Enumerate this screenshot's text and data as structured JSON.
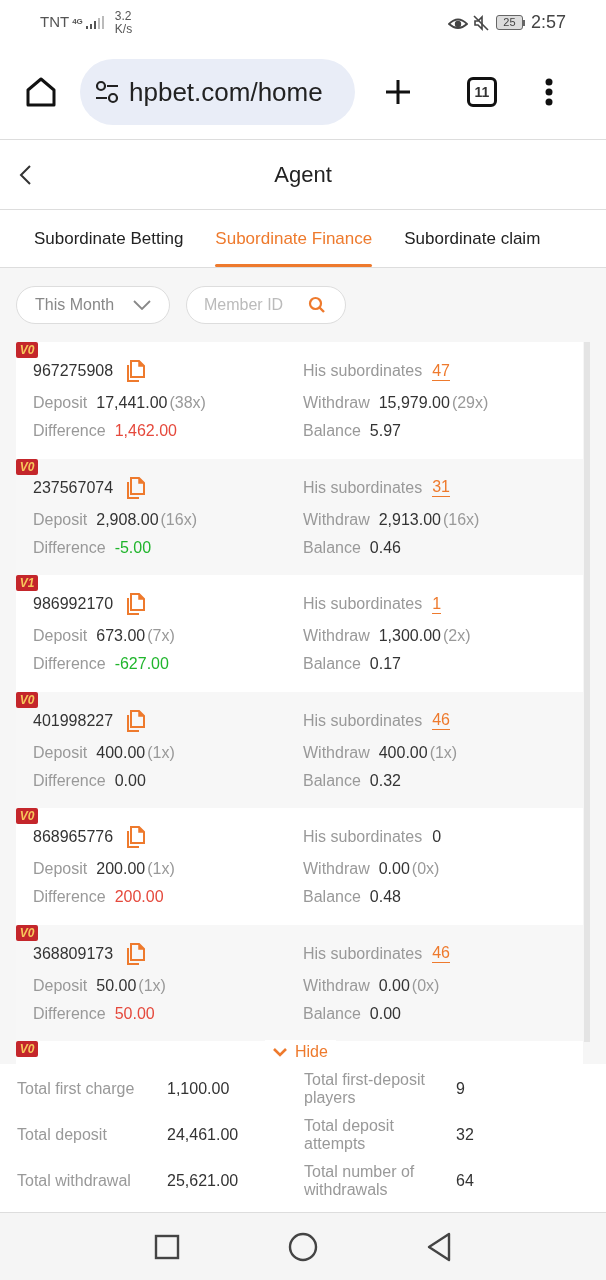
{
  "status_bar": {
    "carrier": "TNT",
    "network": "4G",
    "speed": "3.2",
    "speed_unit": "K/s",
    "battery": "25",
    "time": "2:57"
  },
  "browser": {
    "url": "hpbet.com/home",
    "tab_count": "11"
  },
  "header": {
    "title": "Agent"
  },
  "tabs": [
    {
      "label": "Subordinate Betting",
      "selected": false
    },
    {
      "label": "Subordinate Finance",
      "selected": true
    },
    {
      "label": "Subordinate claim",
      "selected": false
    }
  ],
  "filters": {
    "period": "This Month",
    "search_placeholder": "Member ID"
  },
  "members": [
    {
      "level": "V0",
      "id": "967275908",
      "subordinates_label": "His subordinates",
      "subordinates": "47",
      "link": true,
      "deposit_label": "Deposit",
      "deposit": "17,441.00",
      "deposit_count": "(38x)",
      "withdraw_label": "Withdraw",
      "withdraw": "15,979.00",
      "withdraw_count": "(29x)",
      "difference_label": "Difference",
      "difference": "1,462.00",
      "color": "#e5493c",
      "balance_label": "Balance",
      "balance": "5.97"
    },
    {
      "level": "V0",
      "id": "237567074",
      "subordinates_label": "His subordinates",
      "subordinates": "31",
      "link": true,
      "deposit_label": "Deposit",
      "deposit": "2,908.00",
      "deposit_count": "(16x)",
      "withdraw_label": "Withdraw",
      "withdraw": "2,913.00",
      "withdraw_count": "(16x)",
      "difference_label": "Difference",
      "difference": "-5.00",
      "color": "#20b52c",
      "balance_label": "Balance",
      "balance": "0.46"
    },
    {
      "level": "V1",
      "id": "986992170",
      "subordinates_label": "His subordinates",
      "subordinates": "1",
      "link": true,
      "deposit_label": "Deposit",
      "deposit": "673.00",
      "deposit_count": "(7x)",
      "withdraw_label": "Withdraw",
      "withdraw": "1,300.00",
      "withdraw_count": "(2x)",
      "difference_label": "Difference",
      "difference": "-627.00",
      "color": "#20b52c",
      "balance_label": "Balance",
      "balance": "0.17"
    },
    {
      "level": "V0",
      "id": "401998227",
      "subordinates_label": "His subordinates",
      "subordinates": "46",
      "link": true,
      "deposit_label": "Deposit",
      "deposit": "400.00",
      "deposit_count": "(1x)",
      "withdraw_label": "Withdraw",
      "withdraw": "400.00",
      "withdraw_count": "(1x)",
      "difference_label": "Difference",
      "difference": "0.00",
      "color": "#333333",
      "balance_label": "Balance",
      "balance": "0.32"
    },
    {
      "level": "V0",
      "id": "868965776",
      "subordinates_label": "His subordinates",
      "subordinates": "0",
      "link": false,
      "deposit_label": "Deposit",
      "deposit": "200.00",
      "deposit_count": "(1x)",
      "withdraw_label": "Withdraw",
      "withdraw": "0.00",
      "withdraw_count": "(0x)",
      "difference_label": "Difference",
      "difference": "200.00",
      "color": "#e5493c",
      "balance_label": "Balance",
      "balance": "0.48"
    },
    {
      "level": "V0",
      "id": "368809173",
      "subordinates_label": "His subordinates",
      "subordinates": "46",
      "link": true,
      "deposit_label": "Deposit",
      "deposit": "50.00",
      "deposit_count": "(1x)",
      "withdraw_label": "Withdraw",
      "withdraw": "0.00",
      "withdraw_count": "(0x)",
      "difference_label": "Difference",
      "difference": "50.00",
      "color": "#e5493c",
      "balance_label": "Balance",
      "balance": "0.00"
    }
  ],
  "partial_member": {
    "level": "V0"
  },
  "hide_button": "Hide",
  "summary": [
    {
      "label": "Total first charge",
      "value": "1,100.00",
      "label2": "Total first-deposit players",
      "value2": "9"
    },
    {
      "label": "Total deposit",
      "value": "24,461.00",
      "label2": "Total deposit attempts",
      "value2": "32"
    },
    {
      "label": "Total withdrawal",
      "value": "25,621.00",
      "label2": "Total number of withdrawals",
      "value2": "64"
    }
  ]
}
